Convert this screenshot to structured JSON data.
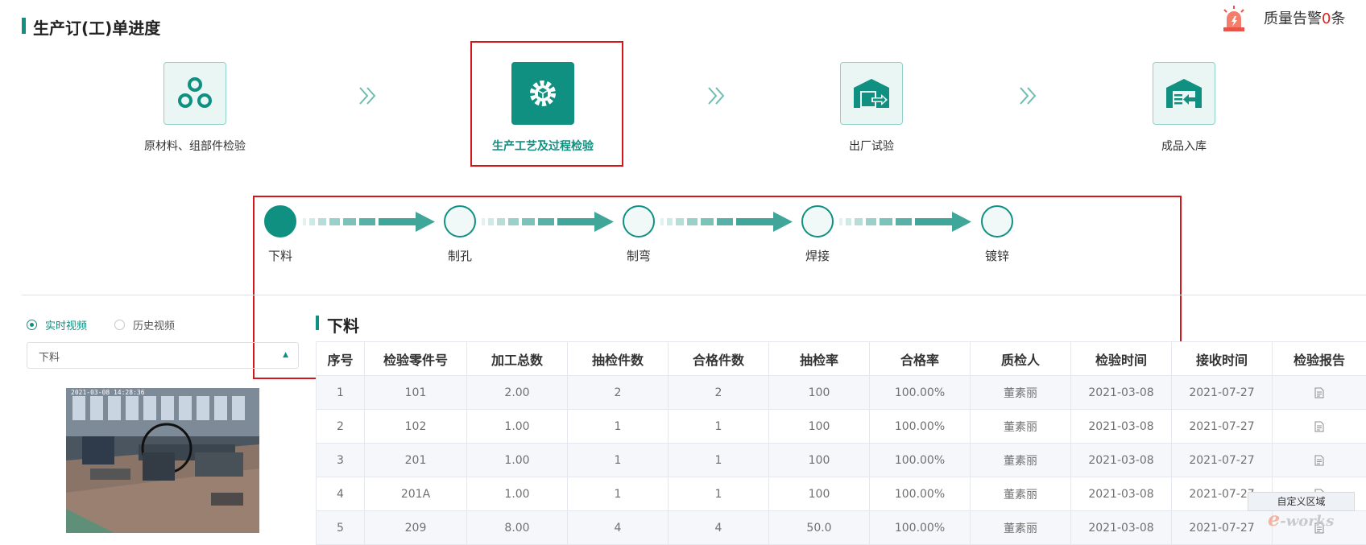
{
  "header": {
    "title": "生产订(工)单进度",
    "alarm_label": "质量告警",
    "alarm_count": "0",
    "alarm_unit": "条"
  },
  "stages": [
    {
      "label": "原材料、组部件检验",
      "icon": "materials-icon",
      "active": false
    },
    {
      "label": "生产工艺及过程检验",
      "icon": "gear-icon",
      "active": true
    },
    {
      "label": "出厂试验",
      "icon": "warehouse-out-icon",
      "active": false
    },
    {
      "label": "成品入库",
      "icon": "warehouse-in-icon",
      "active": false
    }
  ],
  "process_steps": [
    {
      "label": "下料",
      "done": true
    },
    {
      "label": "制孔",
      "done": false
    },
    {
      "label": "制弯",
      "done": false
    },
    {
      "label": "焊接",
      "done": false
    },
    {
      "label": "镀锌",
      "done": false
    }
  ],
  "video_panel": {
    "radio_live": "实时视频",
    "radio_history": "历史视频",
    "selected": "live",
    "select_value": "下料",
    "video_timestamp": "2021-03-08 14:28:36"
  },
  "section_title": "下料",
  "table": {
    "columns": [
      "序号",
      "检验零件号",
      "加工总数",
      "抽检件数",
      "合格件数",
      "抽检率",
      "合格率",
      "质检人",
      "检验时间",
      "接收时间",
      "检验报告"
    ],
    "rows": [
      [
        "1",
        "101",
        "2.00",
        "2",
        "2",
        "100",
        "100.00%",
        "董素丽",
        "2021-03-08",
        "2021-07-27"
      ],
      [
        "2",
        "102",
        "1.00",
        "1",
        "1",
        "100",
        "100.00%",
        "董素丽",
        "2021-03-08",
        "2021-07-27"
      ],
      [
        "3",
        "201",
        "1.00",
        "1",
        "1",
        "100",
        "100.00%",
        "董素丽",
        "2021-03-08",
        "2021-07-27"
      ],
      [
        "4",
        "201A",
        "1.00",
        "1",
        "1",
        "100",
        "100.00%",
        "董素丽",
        "2021-03-08",
        "2021-07-27"
      ],
      [
        "5",
        "209",
        "8.00",
        "4",
        "4",
        "50.0",
        "100.00%",
        "董素丽",
        "2021-03-08",
        "2021-07-27"
      ]
    ]
  },
  "custom_area_label": "自定义区域",
  "watermark": "e-works",
  "colors": {
    "accent": "#0f9080",
    "highlight": "#d4151b",
    "alarm": "#e02020"
  }
}
